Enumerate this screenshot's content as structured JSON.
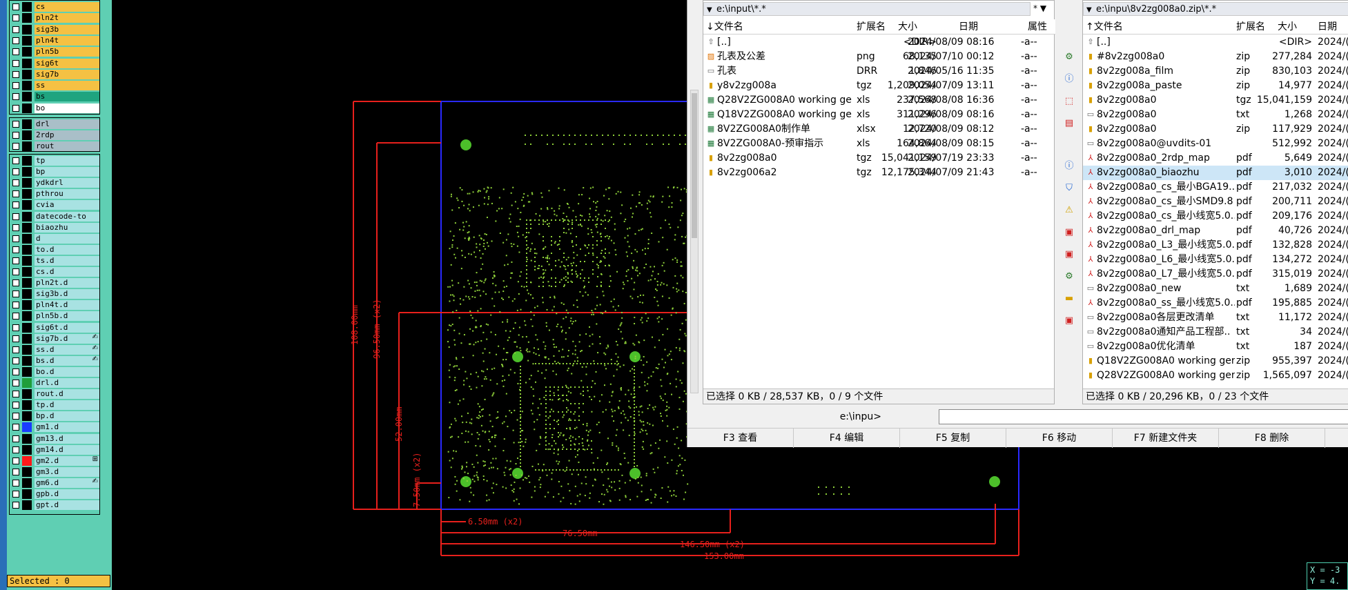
{
  "layers": {
    "group1": [
      {
        "name": "cs",
        "color": "#f5c143",
        "mark": ""
      },
      {
        "name": "pln2t",
        "color": "#f5c143",
        "mark": ""
      },
      {
        "name": "sig3b",
        "color": "#f5c143",
        "mark": ""
      },
      {
        "name": "pln4t",
        "color": "#f5c143",
        "mark": ""
      },
      {
        "name": "pln5b",
        "color": "#f5c143",
        "mark": ""
      },
      {
        "name": "sig6t",
        "color": "#f5c143",
        "mark": ""
      },
      {
        "name": "sig7b",
        "color": "#f5c143",
        "mark": ""
      },
      {
        "name": "ss",
        "color": "#f5c143",
        "mark": ""
      },
      {
        "name": "bs",
        "color": "#1fa47f",
        "mark": ""
      },
      {
        "name": "bo",
        "color": "#ffffff",
        "mark": ""
      }
    ],
    "group2": [
      {
        "name": "drl",
        "color": "#a9bfc8",
        "mark": ""
      },
      {
        "name": "2rdp",
        "color": "#a9bfc8",
        "mark": ""
      },
      {
        "name": "rout",
        "color": "#a9bfc8",
        "mark": ""
      }
    ],
    "group3": [
      {
        "name": "tp",
        "color": "#a8e2e2",
        "mark": "",
        "sw": ""
      },
      {
        "name": "bp",
        "color": "#a8e2e2",
        "mark": "",
        "sw": ""
      },
      {
        "name": "ydkdrl",
        "color": "#a8e2e2",
        "mark": "",
        "sw": ""
      },
      {
        "name": "pthrou",
        "color": "#a8e2e2",
        "mark": "",
        "sw": ""
      },
      {
        "name": "cvia",
        "color": "#a8e2e2",
        "mark": "",
        "sw": ""
      },
      {
        "name": "datecode-to",
        "color": "#a8e2e2",
        "mark": "",
        "sw": ""
      },
      {
        "name": "biaozhu",
        "color": "#a8e2e2",
        "mark": "",
        "sw": ""
      },
      {
        "name": "d",
        "color": "#a8e2e2",
        "mark": "",
        "sw": ""
      },
      {
        "name": "to.d",
        "color": "#a8e2e2",
        "mark": "",
        "sw": ""
      },
      {
        "name": "ts.d",
        "color": "#a8e2e2",
        "mark": "",
        "sw": ""
      },
      {
        "name": "cs.d",
        "color": "#a8e2e2",
        "mark": "",
        "sw": ""
      },
      {
        "name": "pln2t.d",
        "color": "#a8e2e2",
        "mark": "",
        "sw": ""
      },
      {
        "name": "sig3b.d",
        "color": "#a8e2e2",
        "mark": "",
        "sw": ""
      },
      {
        "name": "pln4t.d",
        "color": "#a8e2e2",
        "mark": "",
        "sw": ""
      },
      {
        "name": "pln5b.d",
        "color": "#a8e2e2",
        "mark": "",
        "sw": ""
      },
      {
        "name": "sig6t.d",
        "color": "#a8e2e2",
        "mark": "",
        "sw": ""
      },
      {
        "name": "sig7b.d",
        "color": "#a8e2e2",
        "mark": "✍",
        "sw": ""
      },
      {
        "name": "ss.d",
        "color": "#a8e2e2",
        "mark": "✍",
        "sw": ""
      },
      {
        "name": "bs.d",
        "color": "#a8e2e2",
        "mark": "✍",
        "sw": ""
      },
      {
        "name": "bo.d",
        "color": "#a8e2e2",
        "mark": "",
        "sw": ""
      },
      {
        "name": "drl.d",
        "color": "#a8e2e2",
        "mark": "",
        "sw": "#1f9e3a"
      },
      {
        "name": "rout.d",
        "color": "#a8e2e2",
        "mark": "",
        "sw": ""
      },
      {
        "name": "tp.d",
        "color": "#a8e2e2",
        "mark": "",
        "sw": ""
      },
      {
        "name": "bp.d",
        "color": "#a8e2e2",
        "mark": "",
        "sw": ""
      },
      {
        "name": "gm1.d",
        "color": "#a8e2e2",
        "mark": "",
        "sw": "#1a3cff"
      },
      {
        "name": "gm13.d",
        "color": "#a8e2e2",
        "mark": "",
        "sw": ""
      },
      {
        "name": "gm14.d",
        "color": "#a8e2e2",
        "mark": "",
        "sw": ""
      },
      {
        "name": "gm2.d",
        "color": "#a8e2e2",
        "mark": "⊞",
        "sw": "#ff1a1a"
      },
      {
        "name": "gm3.d",
        "color": "#a8e2e2",
        "mark": "",
        "sw": ""
      },
      {
        "name": "gm6.d",
        "color": "#a8e2e2",
        "mark": "✍",
        "sw": ""
      },
      {
        "name": "gpb.d",
        "color": "#a8e2e2",
        "mark": "",
        "sw": ""
      },
      {
        "name": "gpt.d",
        "color": "#a8e2e2",
        "mark": "",
        "sw": ""
      }
    ]
  },
  "status": {
    "selected": "Selected : 0"
  },
  "coords": {
    "x": "X = -3",
    "y": "Y = 4."
  },
  "dimensions": {
    "d108": "108.00mm",
    "d96": "96.50mm (x2)",
    "d52": "52.00mm",
    "d7": "7.50mm (x2)",
    "d6": "6.50mm (x2)",
    "d76": "76.50mm",
    "d146": "146.50mm (x2)",
    "d153": "153.00mm"
  },
  "fm": {
    "left": {
      "path": "e:\\input\\*.*",
      "sort_marker": "* ▼",
      "headers": {
        "name": "文件名",
        "ext": "扩展名",
        "size": "大小",
        "date": "日期",
        "attr": "属性"
      },
      "rows": [
        {
          "icon": "up",
          "name": "[..]",
          "ext": "",
          "size": "<DIR>",
          "date": "2024/08/09 08:16",
          "attr": "-a--"
        },
        {
          "icon": "img",
          "name": "孔表及公差",
          "ext": "png",
          "size": "68,135",
          "date": "2024/07/10 00:12",
          "attr": "-a--"
        },
        {
          "icon": "doc",
          "name": "孔表",
          "ext": "DRR",
          "size": "1,846",
          "date": "2024/05/16 11:35",
          "attr": "-a--"
        },
        {
          "icon": "zip",
          "name": "y8v2zg008a",
          "ext": "tgz",
          "size": "1,209,054",
          "date": "2024/07/09 13:11",
          "attr": "-a--"
        },
        {
          "icon": "xls",
          "name": "Q28V2ZG008A0 working ger..",
          "ext": "xls",
          "size": "237,568",
          "date": "2024/08/08 16:36",
          "attr": "-a--"
        },
        {
          "icon": "xls",
          "name": "Q18V2ZG008A0 working ger..",
          "ext": "xls",
          "size": "311,296",
          "date": "2024/08/09 08:16",
          "attr": "-a--"
        },
        {
          "icon": "xls",
          "name": "8V2ZG008A0制作单",
          "ext": "xlsx",
          "size": "12,720",
          "date": "2024/08/09 08:12",
          "attr": "-a--"
        },
        {
          "icon": "xls",
          "name": "8V2ZG008A0-预审指示",
          "ext": "xls",
          "size": "164,864",
          "date": "2024/08/09 08:15",
          "attr": "-a--"
        },
        {
          "icon": "zip",
          "name": "8v2zg008a0",
          "ext": "tgz",
          "size": "15,041,159",
          "date": "2024/07/19 23:33",
          "attr": "-a--"
        },
        {
          "icon": "zip",
          "name": "8v2zg006a2",
          "ext": "tgz",
          "size": "12,175,344",
          "date": "2024/07/09 21:43",
          "attr": "-a--"
        }
      ],
      "status": "已选择 0 KB / 28,537 KB，0 / 9 个文件"
    },
    "right": {
      "path": "e:\\inpu\\8v2zg008a0.zip\\*.*",
      "headers": {
        "name": "文件名",
        "ext": "扩展名",
        "size": "大小",
        "date": "日期"
      },
      "rows": [
        {
          "icon": "up",
          "name": "[..]",
          "ext": "",
          "size": "<DIR>",
          "date": "2024/("
        },
        {
          "icon": "zip",
          "name": "#8v2zg008a0",
          "ext": "zip",
          "size": "277,284",
          "date": "2024/("
        },
        {
          "icon": "zip",
          "name": "8v2zg008a_film",
          "ext": "zip",
          "size": "830,103",
          "date": "2024/("
        },
        {
          "icon": "zip",
          "name": "8v2zg008a_paste",
          "ext": "zip",
          "size": "14,977",
          "date": "2024/("
        },
        {
          "icon": "zip",
          "name": "8v2zg008a0",
          "ext": "tgz",
          "size": "15,041,159",
          "date": "2024/("
        },
        {
          "icon": "doc",
          "name": "8v2zg008a0",
          "ext": "txt",
          "size": "1,268",
          "date": "2024/("
        },
        {
          "icon": "zip",
          "name": "8v2zg008a0",
          "ext": "zip",
          "size": "117,929",
          "date": "2024/("
        },
        {
          "icon": "doc",
          "name": "8v2zg008a0@uvdits-01",
          "ext": "",
          "size": "512,992",
          "date": "2024/("
        },
        {
          "icon": "pdf",
          "name": "8v2zg008a0_2rdp_map",
          "ext": "pdf",
          "size": "5,649",
          "date": "2024/("
        },
        {
          "icon": "pdf",
          "name": "8v2zg008a0_biaozhu",
          "ext": "pdf",
          "size": "3,010",
          "date": "2024/(",
          "selected": true
        },
        {
          "icon": "pdf",
          "name": "8v2zg008a0_cs_最小BGA19..",
          "ext": "pdf",
          "size": "217,032",
          "date": "2024/("
        },
        {
          "icon": "pdf",
          "name": "8v2zg008a0_cs_最小SMD9.8",
          "ext": "pdf",
          "size": "200,711",
          "date": "2024/("
        },
        {
          "icon": "pdf",
          "name": "8v2zg008a0_cs_最小线宽5.0..",
          "ext": "pdf",
          "size": "209,176",
          "date": "2024/("
        },
        {
          "icon": "pdf",
          "name": "8v2zg008a0_drl_map",
          "ext": "pdf",
          "size": "40,726",
          "date": "2024/("
        },
        {
          "icon": "pdf",
          "name": "8v2zg008a0_L3_最小线宽5.0..",
          "ext": "pdf",
          "size": "132,828",
          "date": "2024/("
        },
        {
          "icon": "pdf",
          "name": "8v2zg008a0_L6_最小线宽5.0..",
          "ext": "pdf",
          "size": "134,272",
          "date": "2024/("
        },
        {
          "icon": "pdf",
          "name": "8v2zg008a0_L7_最小线宽5.0..",
          "ext": "pdf",
          "size": "315,019",
          "date": "2024/("
        },
        {
          "icon": "doc",
          "name": "8v2zg008a0_new",
          "ext": "txt",
          "size": "1,689",
          "date": "2024/("
        },
        {
          "icon": "pdf",
          "name": "8v2zg008a0_ss_最小线宽5.0..",
          "ext": "pdf",
          "size": "195,885",
          "date": "2024/("
        },
        {
          "icon": "doc",
          "name": "8v2zg008a0各层更改清单",
          "ext": "txt",
          "size": "11,172",
          "date": "2024/("
        },
        {
          "icon": "doc",
          "name": "8v2zg008a0通知产品工程部..",
          "ext": "txt",
          "size": "34",
          "date": "2024/("
        },
        {
          "icon": "doc",
          "name": "8v2zg008a0优化清单",
          "ext": "txt",
          "size": "187",
          "date": "2024/("
        },
        {
          "icon": "zip",
          "name": "Q18V2ZG008A0 working ger..",
          "ext": "zip",
          "size": "955,397",
          "date": "2024/("
        },
        {
          "icon": "zip",
          "name": "Q28V2ZG008A0 working ger..",
          "ext": "zip",
          "size": "1,565,097",
          "date": "2024/("
        }
      ],
      "status": "已选择 0 KB / 20,296 KB，0 / 23 个文件"
    },
    "cmd_label": "e:\\inpu>",
    "fkeys": [
      "F3 查看",
      "F4 编辑",
      "F5 复制",
      "F6 移动",
      "F7 新建文件夹",
      "F8 删除"
    ]
  },
  "colors": {
    "red": "#e8201c",
    "blue": "#2a2aff",
    "green": "#4cbf2a",
    "dots": "#8fd13a"
  }
}
